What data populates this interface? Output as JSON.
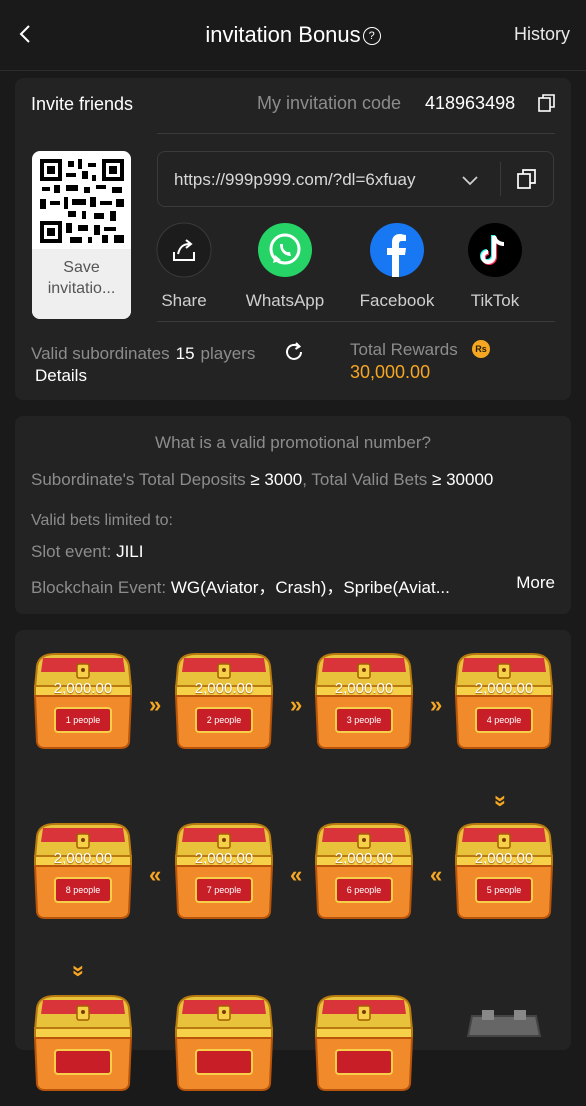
{
  "header": {
    "title": "invitation Bonus",
    "help_glyph": "?",
    "history_label": "History"
  },
  "invite": {
    "label": "Invite friends",
    "code_label": "My invitation code",
    "code_value": "418963498",
    "save_label": "Save invitatio...",
    "url": "https://999p999.com/?dl=6xfuay",
    "share_items": [
      {
        "label": "Share",
        "icon": "share-icon"
      },
      {
        "label": "WhatsApp",
        "icon": "whatsapp-icon"
      },
      {
        "label": "Facebook",
        "icon": "facebook-icon"
      },
      {
        "label": "TikTok",
        "icon": "tiktok-icon"
      }
    ],
    "subordinates_label": "Valid subordinates",
    "subordinates_count": "15",
    "subordinates_unit": "players",
    "details_label": "Details",
    "rewards_label": "Total Rewards",
    "rewards_badge": "Rs",
    "rewards_value": "30,000.00"
  },
  "rules": {
    "question": "What is a valid promotional number?",
    "deposits_label": "Subordinate's Total Deposits",
    "deposits_value": "≥ 3000",
    "bets_label": "Total Valid Bets",
    "bets_value": "≥ 30000",
    "limited_label": "Valid bets limited to:",
    "slot_label": "Slot event:",
    "slot_value": "JILI",
    "chain_label": "Blockchain Event:",
    "chain_value": "WG(Aviator，Crash)，Spribe(Aviat...",
    "more_label": "More"
  },
  "chests": [
    {
      "amount": "2,000.00",
      "people": "1 people"
    },
    {
      "amount": "2,000.00",
      "people": "2 people"
    },
    {
      "amount": "2,000.00",
      "people": "3 people"
    },
    {
      "amount": "2,000.00",
      "people": "4 people"
    },
    {
      "amount": "2,000.00",
      "people": "5 people"
    },
    {
      "amount": "2,000.00",
      "people": "6 people"
    },
    {
      "amount": "2,000.00",
      "people": "7 people"
    },
    {
      "amount": "2,000.00",
      "people": "8 people"
    }
  ],
  "colors": {
    "background": "#1a1a1a",
    "card": "#232323",
    "accent": "#f5a623",
    "muted_text": "#8c8c8c"
  }
}
